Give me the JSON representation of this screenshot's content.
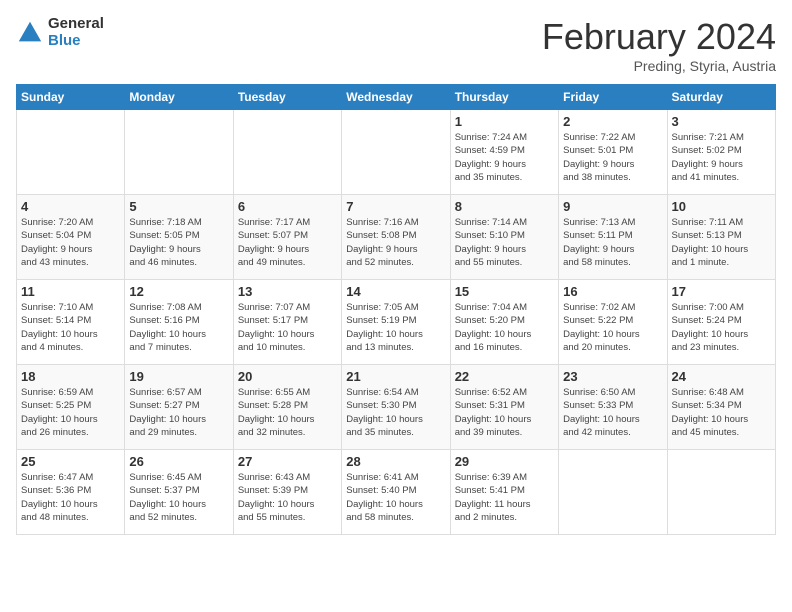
{
  "header": {
    "logo_line1": "General",
    "logo_line2": "Blue",
    "title": "February 2024",
    "subtitle": "Preding, Styria, Austria"
  },
  "calendar": {
    "headers": [
      "Sunday",
      "Monday",
      "Tuesday",
      "Wednesday",
      "Thursday",
      "Friday",
      "Saturday"
    ],
    "weeks": [
      [
        {
          "day": "",
          "info": ""
        },
        {
          "day": "",
          "info": ""
        },
        {
          "day": "",
          "info": ""
        },
        {
          "day": "",
          "info": ""
        },
        {
          "day": "1",
          "info": "Sunrise: 7:24 AM\nSunset: 4:59 PM\nDaylight: 9 hours\nand 35 minutes."
        },
        {
          "day": "2",
          "info": "Sunrise: 7:22 AM\nSunset: 5:01 PM\nDaylight: 9 hours\nand 38 minutes."
        },
        {
          "day": "3",
          "info": "Sunrise: 7:21 AM\nSunset: 5:02 PM\nDaylight: 9 hours\nand 41 minutes."
        }
      ],
      [
        {
          "day": "4",
          "info": "Sunrise: 7:20 AM\nSunset: 5:04 PM\nDaylight: 9 hours\nand 43 minutes."
        },
        {
          "day": "5",
          "info": "Sunrise: 7:18 AM\nSunset: 5:05 PM\nDaylight: 9 hours\nand 46 minutes."
        },
        {
          "day": "6",
          "info": "Sunrise: 7:17 AM\nSunset: 5:07 PM\nDaylight: 9 hours\nand 49 minutes."
        },
        {
          "day": "7",
          "info": "Sunrise: 7:16 AM\nSunset: 5:08 PM\nDaylight: 9 hours\nand 52 minutes."
        },
        {
          "day": "8",
          "info": "Sunrise: 7:14 AM\nSunset: 5:10 PM\nDaylight: 9 hours\nand 55 minutes."
        },
        {
          "day": "9",
          "info": "Sunrise: 7:13 AM\nSunset: 5:11 PM\nDaylight: 9 hours\nand 58 minutes."
        },
        {
          "day": "10",
          "info": "Sunrise: 7:11 AM\nSunset: 5:13 PM\nDaylight: 10 hours\nand 1 minute."
        }
      ],
      [
        {
          "day": "11",
          "info": "Sunrise: 7:10 AM\nSunset: 5:14 PM\nDaylight: 10 hours\nand 4 minutes."
        },
        {
          "day": "12",
          "info": "Sunrise: 7:08 AM\nSunset: 5:16 PM\nDaylight: 10 hours\nand 7 minutes."
        },
        {
          "day": "13",
          "info": "Sunrise: 7:07 AM\nSunset: 5:17 PM\nDaylight: 10 hours\nand 10 minutes."
        },
        {
          "day": "14",
          "info": "Sunrise: 7:05 AM\nSunset: 5:19 PM\nDaylight: 10 hours\nand 13 minutes."
        },
        {
          "day": "15",
          "info": "Sunrise: 7:04 AM\nSunset: 5:20 PM\nDaylight: 10 hours\nand 16 minutes."
        },
        {
          "day": "16",
          "info": "Sunrise: 7:02 AM\nSunset: 5:22 PM\nDaylight: 10 hours\nand 20 minutes."
        },
        {
          "day": "17",
          "info": "Sunrise: 7:00 AM\nSunset: 5:24 PM\nDaylight: 10 hours\nand 23 minutes."
        }
      ],
      [
        {
          "day": "18",
          "info": "Sunrise: 6:59 AM\nSunset: 5:25 PM\nDaylight: 10 hours\nand 26 minutes."
        },
        {
          "day": "19",
          "info": "Sunrise: 6:57 AM\nSunset: 5:27 PM\nDaylight: 10 hours\nand 29 minutes."
        },
        {
          "day": "20",
          "info": "Sunrise: 6:55 AM\nSunset: 5:28 PM\nDaylight: 10 hours\nand 32 minutes."
        },
        {
          "day": "21",
          "info": "Sunrise: 6:54 AM\nSunset: 5:30 PM\nDaylight: 10 hours\nand 35 minutes."
        },
        {
          "day": "22",
          "info": "Sunrise: 6:52 AM\nSunset: 5:31 PM\nDaylight: 10 hours\nand 39 minutes."
        },
        {
          "day": "23",
          "info": "Sunrise: 6:50 AM\nSunset: 5:33 PM\nDaylight: 10 hours\nand 42 minutes."
        },
        {
          "day": "24",
          "info": "Sunrise: 6:48 AM\nSunset: 5:34 PM\nDaylight: 10 hours\nand 45 minutes."
        }
      ],
      [
        {
          "day": "25",
          "info": "Sunrise: 6:47 AM\nSunset: 5:36 PM\nDaylight: 10 hours\nand 48 minutes."
        },
        {
          "day": "26",
          "info": "Sunrise: 6:45 AM\nSunset: 5:37 PM\nDaylight: 10 hours\nand 52 minutes."
        },
        {
          "day": "27",
          "info": "Sunrise: 6:43 AM\nSunset: 5:39 PM\nDaylight: 10 hours\nand 55 minutes."
        },
        {
          "day": "28",
          "info": "Sunrise: 6:41 AM\nSunset: 5:40 PM\nDaylight: 10 hours\nand 58 minutes."
        },
        {
          "day": "29",
          "info": "Sunrise: 6:39 AM\nSunset: 5:41 PM\nDaylight: 11 hours\nand 2 minutes."
        },
        {
          "day": "",
          "info": ""
        },
        {
          "day": "",
          "info": ""
        }
      ]
    ]
  }
}
